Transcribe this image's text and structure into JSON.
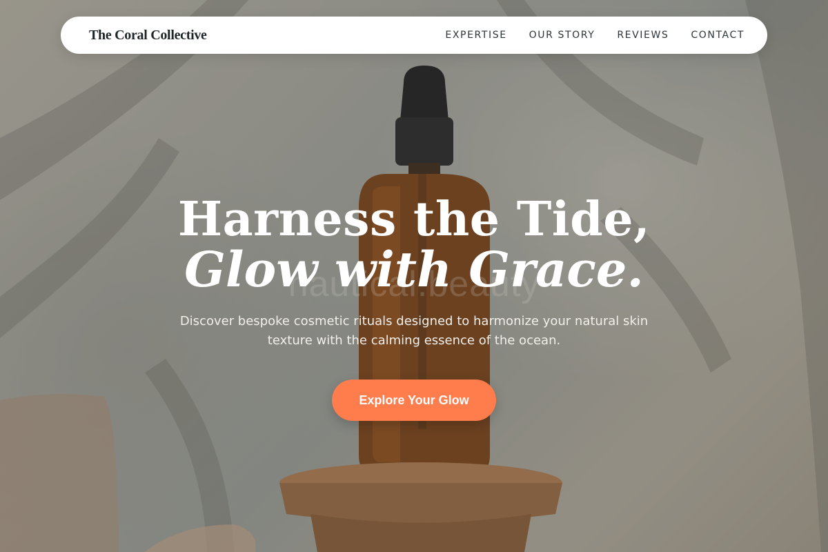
{
  "brand": {
    "name": "The Coral Collective"
  },
  "nav": {
    "items": [
      "EXPERTISE",
      "OUR STORY",
      "REVIEWS",
      "CONTACT"
    ]
  },
  "hero": {
    "headline_line1": "Harness the Tide,",
    "headline_line2": "Glow with Grace.",
    "subtext": "Discover bespoke cosmetic rituals designed to harmonize your natural skin texture with the calming essence of the ocean.",
    "cta_label": "Explore Your Glow",
    "bottle_label": "nautical.beauty"
  },
  "colors": {
    "accent": "#ff7c4c",
    "nav_bg": "#ffffff",
    "brand_text": "#1e2528",
    "headline": "#ffffff"
  }
}
